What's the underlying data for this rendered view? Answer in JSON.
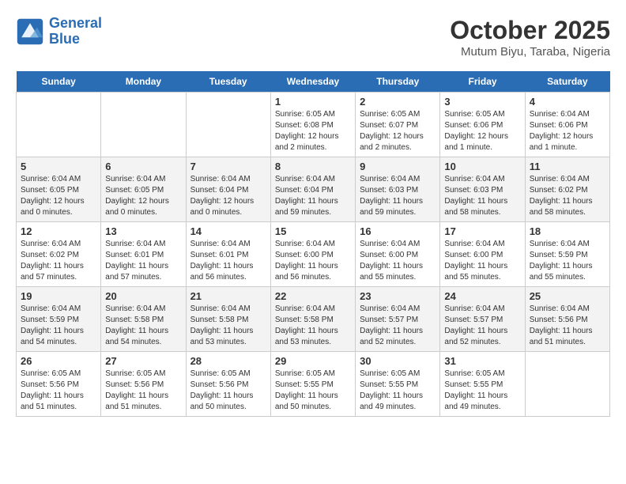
{
  "header": {
    "logo_line1": "General",
    "logo_line2": "Blue",
    "month": "October 2025",
    "location": "Mutum Biyu, Taraba, Nigeria"
  },
  "days_of_week": [
    "Sunday",
    "Monday",
    "Tuesday",
    "Wednesday",
    "Thursday",
    "Friday",
    "Saturday"
  ],
  "weeks": [
    [
      {
        "day": "",
        "info": ""
      },
      {
        "day": "",
        "info": ""
      },
      {
        "day": "",
        "info": ""
      },
      {
        "day": "1",
        "info": "Sunrise: 6:05 AM\nSunset: 6:08 PM\nDaylight: 12 hours\nand 2 minutes."
      },
      {
        "day": "2",
        "info": "Sunrise: 6:05 AM\nSunset: 6:07 PM\nDaylight: 12 hours\nand 2 minutes."
      },
      {
        "day": "3",
        "info": "Sunrise: 6:05 AM\nSunset: 6:06 PM\nDaylight: 12 hours\nand 1 minute."
      },
      {
        "day": "4",
        "info": "Sunrise: 6:04 AM\nSunset: 6:06 PM\nDaylight: 12 hours\nand 1 minute."
      }
    ],
    [
      {
        "day": "5",
        "info": "Sunrise: 6:04 AM\nSunset: 6:05 PM\nDaylight: 12 hours\nand 0 minutes."
      },
      {
        "day": "6",
        "info": "Sunrise: 6:04 AM\nSunset: 6:05 PM\nDaylight: 12 hours\nand 0 minutes."
      },
      {
        "day": "7",
        "info": "Sunrise: 6:04 AM\nSunset: 6:04 PM\nDaylight: 12 hours\nand 0 minutes."
      },
      {
        "day": "8",
        "info": "Sunrise: 6:04 AM\nSunset: 6:04 PM\nDaylight: 11 hours\nand 59 minutes."
      },
      {
        "day": "9",
        "info": "Sunrise: 6:04 AM\nSunset: 6:03 PM\nDaylight: 11 hours\nand 59 minutes."
      },
      {
        "day": "10",
        "info": "Sunrise: 6:04 AM\nSunset: 6:03 PM\nDaylight: 11 hours\nand 58 minutes."
      },
      {
        "day": "11",
        "info": "Sunrise: 6:04 AM\nSunset: 6:02 PM\nDaylight: 11 hours\nand 58 minutes."
      }
    ],
    [
      {
        "day": "12",
        "info": "Sunrise: 6:04 AM\nSunset: 6:02 PM\nDaylight: 11 hours\nand 57 minutes."
      },
      {
        "day": "13",
        "info": "Sunrise: 6:04 AM\nSunset: 6:01 PM\nDaylight: 11 hours\nand 57 minutes."
      },
      {
        "day": "14",
        "info": "Sunrise: 6:04 AM\nSunset: 6:01 PM\nDaylight: 11 hours\nand 56 minutes."
      },
      {
        "day": "15",
        "info": "Sunrise: 6:04 AM\nSunset: 6:00 PM\nDaylight: 11 hours\nand 56 minutes."
      },
      {
        "day": "16",
        "info": "Sunrise: 6:04 AM\nSunset: 6:00 PM\nDaylight: 11 hours\nand 55 minutes."
      },
      {
        "day": "17",
        "info": "Sunrise: 6:04 AM\nSunset: 6:00 PM\nDaylight: 11 hours\nand 55 minutes."
      },
      {
        "day": "18",
        "info": "Sunrise: 6:04 AM\nSunset: 5:59 PM\nDaylight: 11 hours\nand 55 minutes."
      }
    ],
    [
      {
        "day": "19",
        "info": "Sunrise: 6:04 AM\nSunset: 5:59 PM\nDaylight: 11 hours\nand 54 minutes."
      },
      {
        "day": "20",
        "info": "Sunrise: 6:04 AM\nSunset: 5:58 PM\nDaylight: 11 hours\nand 54 minutes."
      },
      {
        "day": "21",
        "info": "Sunrise: 6:04 AM\nSunset: 5:58 PM\nDaylight: 11 hours\nand 53 minutes."
      },
      {
        "day": "22",
        "info": "Sunrise: 6:04 AM\nSunset: 5:58 PM\nDaylight: 11 hours\nand 53 minutes."
      },
      {
        "day": "23",
        "info": "Sunrise: 6:04 AM\nSunset: 5:57 PM\nDaylight: 11 hours\nand 52 minutes."
      },
      {
        "day": "24",
        "info": "Sunrise: 6:04 AM\nSunset: 5:57 PM\nDaylight: 11 hours\nand 52 minutes."
      },
      {
        "day": "25",
        "info": "Sunrise: 6:04 AM\nSunset: 5:56 PM\nDaylight: 11 hours\nand 51 minutes."
      }
    ],
    [
      {
        "day": "26",
        "info": "Sunrise: 6:05 AM\nSunset: 5:56 PM\nDaylight: 11 hours\nand 51 minutes."
      },
      {
        "day": "27",
        "info": "Sunrise: 6:05 AM\nSunset: 5:56 PM\nDaylight: 11 hours\nand 51 minutes."
      },
      {
        "day": "28",
        "info": "Sunrise: 6:05 AM\nSunset: 5:56 PM\nDaylight: 11 hours\nand 50 minutes."
      },
      {
        "day": "29",
        "info": "Sunrise: 6:05 AM\nSunset: 5:55 PM\nDaylight: 11 hours\nand 50 minutes."
      },
      {
        "day": "30",
        "info": "Sunrise: 6:05 AM\nSunset: 5:55 PM\nDaylight: 11 hours\nand 49 minutes."
      },
      {
        "day": "31",
        "info": "Sunrise: 6:05 AM\nSunset: 5:55 PM\nDaylight: 11 hours\nand 49 minutes."
      },
      {
        "day": "",
        "info": ""
      }
    ]
  ]
}
